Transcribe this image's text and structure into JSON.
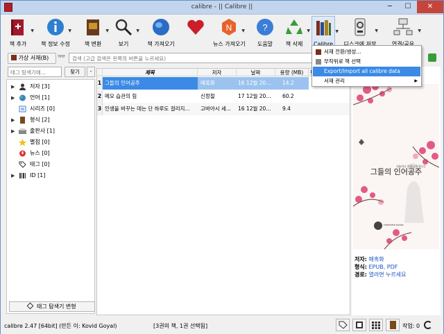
{
  "window": {
    "title": "calibre - || Calibre ||",
    "min": "─",
    "max": "☐",
    "close": "✕"
  },
  "toolbar": {
    "add_books": "책 추가",
    "edit_metadata": "책 정보 수정",
    "convert": "책 변환",
    "view": "보기",
    "get_books": "책 가져오기",
    "fetch_news": "뉴스 가져오기",
    "help": "도움말",
    "remove": "책 삭제",
    "calibre": "Calibre",
    "save_to_disk": "디스크에 저장",
    "connect_share": "연결/공유",
    "dropdown_arrow": "▼"
  },
  "search": {
    "virtual_library": "가상 서재(B)",
    "placeholder": "검색 (고급 검색은 왼쪽의 버튼을 누르세요)",
    "dropdown_arrow": "▼",
    "clear_icon": "✕",
    "binoculars": "👓"
  },
  "tag_browser": {
    "filter_placeholder": "태그 탐색기에…",
    "find_label": "찾기",
    "collapse_label": "-",
    "manage_label": "태그 탐색기 변형",
    "nodes": [
      {
        "label": "저자 [3]",
        "expand": "▶",
        "icon": "person-icon"
      },
      {
        "label": "언어 [1]",
        "expand": "▶",
        "icon": "globe-icon"
      },
      {
        "label": "시리즈 [0]",
        "expand": "",
        "icon": "series-icon"
      },
      {
        "label": "형식 [2]",
        "expand": "▶",
        "icon": "book-icon"
      },
      {
        "label": "출판사 [1]",
        "expand": "▶",
        "icon": "publisher-icon"
      },
      {
        "label": "별점 [0]",
        "expand": "",
        "icon": "star-icon"
      },
      {
        "label": "뉴스 [0]",
        "expand": "",
        "icon": "news-icon"
      },
      {
        "label": "태그 [0]",
        "expand": "",
        "icon": "tag-icon"
      },
      {
        "label": "ID [1]",
        "expand": "▶",
        "icon": "id-icon"
      }
    ]
  },
  "book_list": {
    "columns": [
      "제목",
      "저자",
      "날짜",
      "용량 (MB)",
      "평"
    ],
    "rows": [
      {
        "num": "1",
        "title": "그들의 인어공주",
        "author": "매혹화",
        "date": "16 12월 20...",
        "size": "14.2"
      },
      {
        "num": "2",
        "title": "메모 습관의 힘",
        "author": "신정철",
        "date": "17 12월 20...",
        "size": "60.2"
      },
      {
        "num": "3",
        "title": "인생을 바꾸는 데는 단 하루도 걸리지...",
        "author": "고바야시 세...",
        "date": "16 12월 20...",
        "size": "9.4"
      }
    ]
  },
  "calibre_menu": {
    "items": [
      {
        "label": "서재 전환/생성...",
        "icon": "library-icon"
      },
      {
        "label": "무작위로 책 선택",
        "icon": "random-icon"
      },
      {
        "label": "Export/Import all calibre data",
        "icon": ""
      },
      {
        "label": "서재 관리",
        "icon": ""
      }
    ],
    "submenu_arrow": "▶"
  },
  "book_details": {
    "cover_title": "그들의 인어공주",
    "cover_subtitle": "서늘하고 아름답게 빛나는",
    "cover_publisher": "celebrate\nbooks",
    "author_key": "저자:",
    "author_val": "매혹화",
    "format_key": "형식:",
    "format_val": "EPUB, PDF",
    "path_key": "경로:",
    "path_val": "열려면 누르세요"
  },
  "status": {
    "left": "calibre 2.47 [64bit] (만든 이: Kovid Goyal)",
    "center": "[3권의 책, 1권 선택됨]",
    "jobs": "작업: 0"
  }
}
